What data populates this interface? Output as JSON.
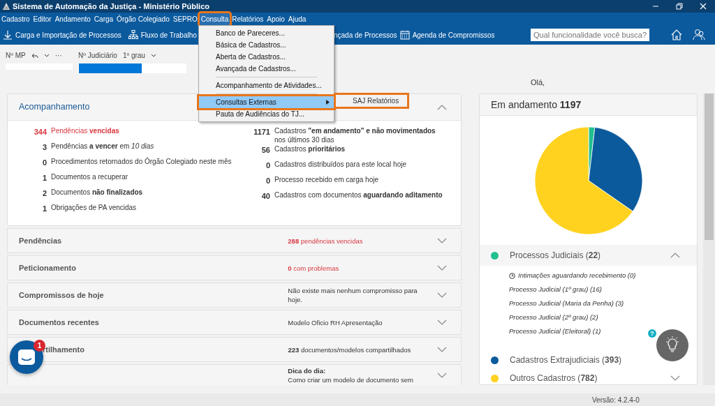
{
  "window": {
    "title": "Sistema de Automação da Justiça - Ministério Público"
  },
  "menu_bar": [
    {
      "label": "Cadastro",
      "highlighted": false
    },
    {
      "label": "Editor",
      "highlighted": false
    },
    {
      "label": "Andamento",
      "highlighted": false
    },
    {
      "label": "Carga",
      "highlighted": false
    },
    {
      "label": "Órgão Colegiado",
      "highlighted": false
    },
    {
      "label": "SEPRO",
      "highlighted": false
    },
    {
      "label": "Consulta",
      "highlighted": true
    },
    {
      "label": "Relatórios",
      "highlighted": false
    },
    {
      "label": "Apoio",
      "highlighted": false
    },
    {
      "label": "Ajuda",
      "highlighted": false
    }
  ],
  "dropdown": [
    {
      "kind": "item",
      "label": "Banco de Pareceres...",
      "selected": false,
      "highlighted": false
    },
    {
      "kind": "item",
      "label": "Básica de Cadastros...",
      "selected": false,
      "highlighted": false
    },
    {
      "kind": "item",
      "label": "Aberta de Cadastros...",
      "selected": false,
      "highlighted": false
    },
    {
      "kind": "item",
      "label": "Avançada de Cadastros...",
      "selected": false,
      "highlighted": false
    },
    {
      "kind": "separator"
    },
    {
      "kind": "item",
      "label": "Acompanhamento de Atividades...",
      "selected": false,
      "highlighted": false
    },
    {
      "kind": "separator"
    },
    {
      "kind": "submenu",
      "label": "Consultas Externas",
      "selected": true,
      "highlighted": true,
      "children": [
        {
          "label": "SAJ Relatórios",
          "selected": false,
          "highlighted": true
        }
      ]
    },
    {
      "kind": "item",
      "label": "Pauta de Audiências do TJ...",
      "selected": false,
      "highlighted": false
    }
  ],
  "toolbar": [
    {
      "kind": "download",
      "label": "Carga e Importação de Processos"
    },
    {
      "kind": "flow",
      "label": "Fluxo de Trabalho"
    },
    {
      "kind": "cut",
      "label": "nçada de Processos"
    },
    {
      "kind": "calendar",
      "label": "Agenda de Compromissos"
    }
  ],
  "search": {
    "placeholder": "Qual funcionalidade você busca?"
  },
  "fields": {
    "mp_label": "Nº MP",
    "more": "···",
    "judicial_label": "Nº Judiciário",
    "degree": "1º grau"
  },
  "greeting": "Olá,",
  "acompanhamento": {
    "title": "Acompanhamento",
    "expanded": true,
    "left": [
      {
        "count": "344",
        "text": "Pendências **vencidas**",
        "alert": true
      },
      {
        "count": "3",
        "text": "Pendências **a vencer** em *10 dias*",
        "alert": false
      },
      {
        "count": "0",
        "text": "Procedimentos retornados do Órgão Colegiado neste mês",
        "alert": false
      },
      {
        "count": "1",
        "text": "Documentos a recuperar",
        "alert": false
      },
      {
        "count": "2",
        "text": "Documentos **não finalizados**",
        "alert": false
      },
      {
        "count": "1",
        "text": "Obrigações de PA vencidas",
        "alert": false
      }
    ],
    "right": [
      {
        "count": "1171",
        "text": "Cadastros **\"em andamento\" e não movimentados** nos últimos 30 dias",
        "alert": false
      },
      {
        "count": "56",
        "text": "Cadastros **prioritários**",
        "alert": false
      },
      {
        "count": "0",
        "text": "Cadastros distribuídos para este local hoje",
        "alert": false
      },
      {
        "count": "0",
        "text": "Processo recebido em carga hoje",
        "alert": false
      },
      {
        "count": "40",
        "text": "Cadastros com documentos **aguardando aditamento**",
        "alert": false
      }
    ]
  },
  "sections": [
    {
      "title": "Pendências",
      "summary": "**288** pendências vencidas",
      "alert": true,
      "expanded": false
    },
    {
      "title": "Peticionamento",
      "summary": "**0** com problemas",
      "alert": true,
      "expanded": false
    },
    {
      "title": "Compromissos de hoje",
      "summary": "Não existe mais nenhum compromisso para hoje.",
      "alert": false,
      "expanded": false
    },
    {
      "title": "Documentos recentes",
      "summary": "Modelo Oficio RH Apresentação",
      "alert": false,
      "expanded": false
    },
    {
      "title": "rtilhamento",
      "summary": "**223** documentos/modelos compartilhados",
      "alert": false,
      "expanded": false
    },
    {
      "summary": "**Dica do dia:**",
      "detail": "Como criar um modelo de documento sem",
      "alert": false,
      "expanded": false
    }
  ],
  "chat": {
    "badge": "1"
  },
  "status_panel": {
    "title": "Em andamento **1197**",
    "chart_data": {
      "type": "pie",
      "values": [
        1.84,
        32.83,
        65.33
      ]
    },
    "legend": [
      {
        "label": "Processos Judiciais (**22**)",
        "color": "#20c08f",
        "expanded": true,
        "children": [
          {
            "label": "Intimações aguardando recebimento (0)",
            "kind": "clock"
          },
          {
            "label": "Processo Judicial (1º grau) (16)",
            "kind": "plain"
          },
          {
            "label": "Processo Judicial (Maria da Penha) (3)",
            "kind": "plain"
          },
          {
            "label": "Processo Judicial (2º grau) (2)",
            "kind": "plain"
          },
          {
            "label": "Processo Judicial (Eleitoral) (1)",
            "kind": "plain"
          }
        ]
      },
      {
        "label": "Cadastros Extrajudiciais (**393**)",
        "color": "#0b5a9c",
        "expanded": false,
        "chevron": false
      },
      {
        "label": "Outros Cadastros (**782**)",
        "color": "#ffd21f",
        "expanded": false,
        "chevron": true
      }
    ]
  },
  "help": {
    "label": "?"
  },
  "status_bar": {
    "version": "Versão: 4.2.4-0"
  }
}
